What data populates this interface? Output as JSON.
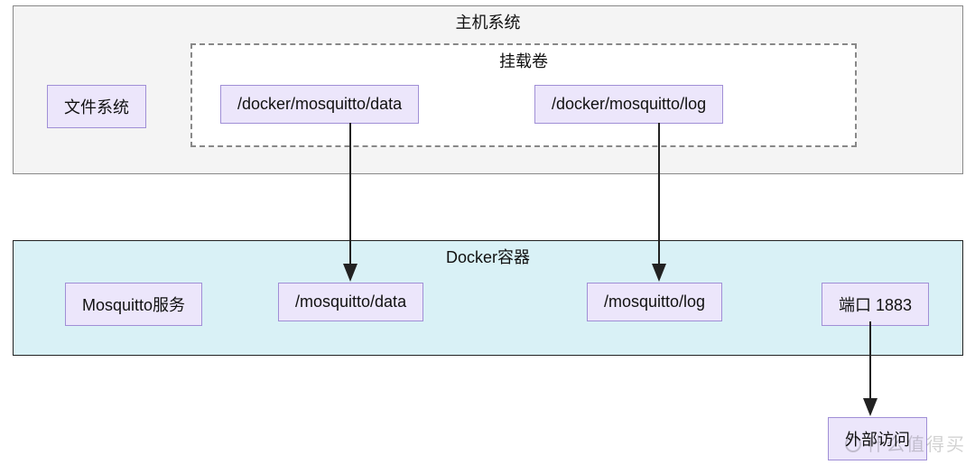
{
  "diagram": {
    "host": {
      "label": "主机系统",
      "fs_node": "文件系统",
      "mount": {
        "label": "挂载卷",
        "data_path": "/docker/mosquitto/data",
        "log_path": "/docker/mosquitto/log"
      }
    },
    "container": {
      "label": "Docker容器",
      "service": "Mosquitto服务",
      "data_path": "/mosquitto/data",
      "log_path": "/mosquitto/log",
      "port": "端口 1883"
    },
    "external": {
      "access": "外部访问"
    },
    "edges": [
      {
        "from": "host.mount.data_path",
        "to": "container.data_path"
      },
      {
        "from": "host.mount.log_path",
        "to": "container.log_path"
      },
      {
        "from": "container.port",
        "to": "external.access"
      }
    ]
  },
  "watermark": "什么值得买"
}
